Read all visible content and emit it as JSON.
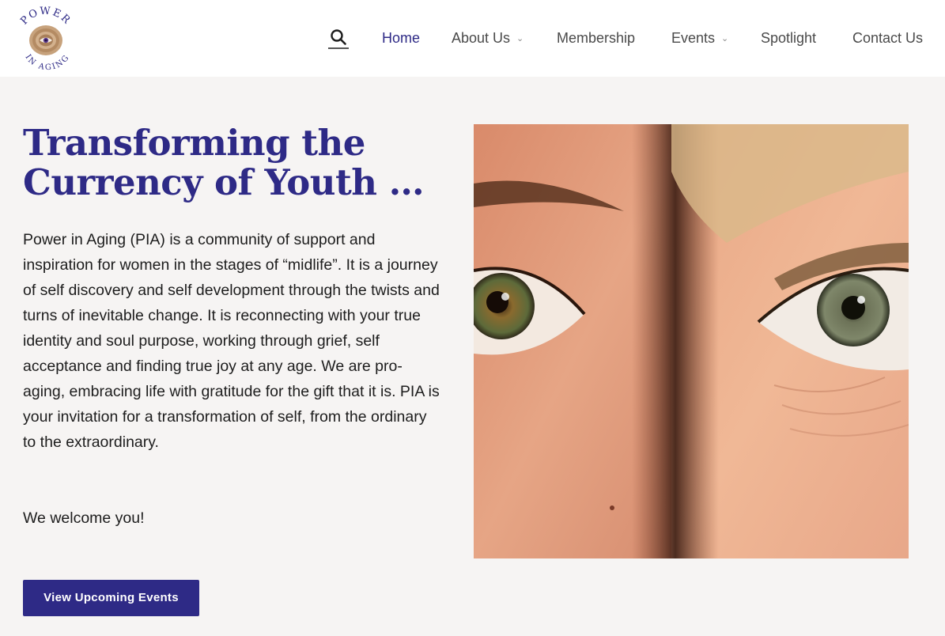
{
  "header": {
    "logo": {
      "text_top": "POWER",
      "text_bottom": "IN AGING",
      "icon": "tree-ring-eye-logo"
    },
    "search_icon": "search-icon",
    "nav": [
      {
        "label": "Home",
        "active": true,
        "has_dropdown": false
      },
      {
        "label": "About Us",
        "active": false,
        "has_dropdown": true
      },
      {
        "label": "Membership",
        "active": false,
        "has_dropdown": false
      },
      {
        "label": "Events",
        "active": false,
        "has_dropdown": true
      },
      {
        "label": "Spotlight",
        "active": false,
        "has_dropdown": false
      },
      {
        "label": "Contact Us",
        "active": false,
        "has_dropdown": false
      }
    ]
  },
  "hero": {
    "title": "Transforming the Currency of Youth …",
    "body": "Power in Aging (PIA) is a community of support and inspiration for women in the stages of “midlife”. It is a journey of self discovery and self development through the twists and turns of inevitable change. It is reconnecting with your true identity and soul purpose, working through grief, self acceptance and finding true joy at any age. We are pro-aging, embracing life with gratitude for the gift that it is. PIA is your invitation for a transformation of self, from the ordinary to the extraordinary.",
    "welcome": "We welcome you!",
    "cta_label": "View Upcoming Events",
    "image_subject": "two-faces-eyes-closeup"
  },
  "colors": {
    "brand": "#2e2a86",
    "background": "#f6f4f3",
    "header_bg": "#ffffff",
    "nav_text": "#4a4a4a"
  }
}
